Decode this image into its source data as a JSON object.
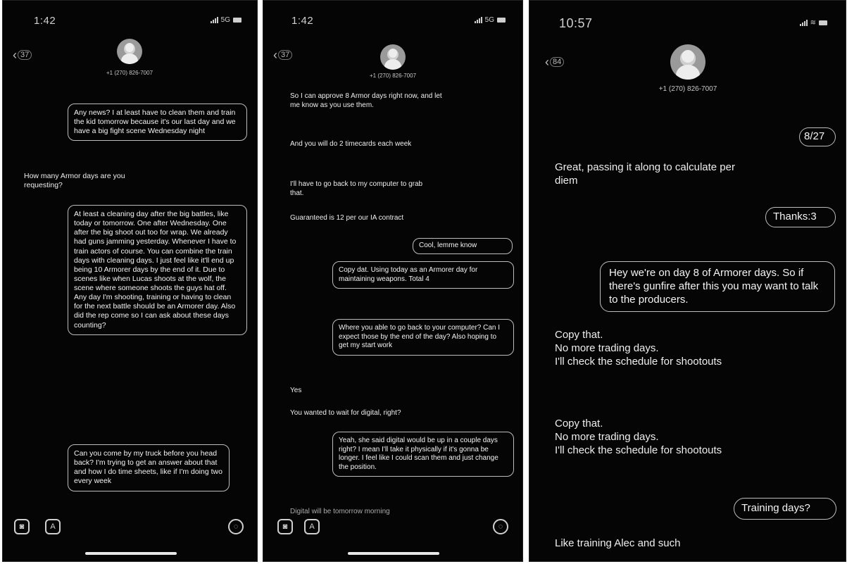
{
  "panels": [
    {
      "status_time": "1:42",
      "status_net": "5G",
      "back_label": "37",
      "contact_phone": "+1 (270) 826-7007",
      "messages": [
        {
          "type": "outgoing",
          "text": "Any news? I at least have to clean them and train the kid tomorrow because it's our last day and we have a big fight scene Wednesday night"
        },
        {
          "type": "incoming",
          "text": "How many Armor days are you requesting?"
        },
        {
          "type": "outgoing",
          "text": "At least a cleaning day after the big battles, like today or tomorrow. One after Wednesday. One after the big shoot out too for wrap. We already had guns jamming yesterday. Whenever I have to train actors of course. You can combine the train days with cleaning days. I just feel like it'll end up being 10 Armorer days by the end of it. Due to scenes like when Lucas shoots at the wolf, the scene where someone shoots the guys hat off. Any day I'm shooting, training or having to clean for the next battle should be an Armorer day. Also did the rep come so I can ask about these days counting?"
        },
        {
          "type": "outgoing",
          "text": "Can you come by my truck before you head back? I'm trying to get an answer about that and how I do time sheets, like if I'm doing two every week"
        }
      ]
    },
    {
      "status_time": "1:42",
      "status_net": "5G",
      "back_label": "37",
      "contact_phone": "+1 (270) 826-7007",
      "messages": [
        {
          "type": "incoming",
          "text": "So I can approve 8 Armor days right now, and let me know as you use them."
        },
        {
          "type": "incoming",
          "text": "And you will do 2 timecards each week"
        },
        {
          "type": "incoming",
          "text": "I'll have to go back to my computer to grab that."
        },
        {
          "type": "incoming",
          "text": "Guaranteed is 12 per our IA contract"
        },
        {
          "type": "outgoing",
          "text": "Cool, lemme know"
        },
        {
          "type": "outgoing",
          "text": "Copy dat. Using today as an Armorer day for maintaining weapons. Total 4"
        },
        {
          "type": "outgoing",
          "text": "Where you able to go back to your computer? Can I expect those by the end of the day? Also hoping to get my start work"
        },
        {
          "type": "incoming",
          "text": "Yes"
        },
        {
          "type": "incoming",
          "text": "You wanted to wait for digital, right?"
        },
        {
          "type": "outgoing",
          "text": "Yeah, she said digital would be up in a couple days right? I mean I'll take it physically if it's gonna be longer. I feel like I could scan them and just change the position."
        },
        {
          "type": "incoming",
          "text": "Digital will be tomorrow morning"
        }
      ]
    },
    {
      "status_time": "10:57",
      "back_label": "84",
      "contact_phone": "+1 (270) 826-7007",
      "messages": [
        {
          "type": "outgoing",
          "text": "8/27"
        },
        {
          "type": "incoming",
          "text": "Great, passing it along to calculate per diem"
        },
        {
          "type": "outgoing",
          "text": "Thanks:3"
        },
        {
          "type": "outgoing",
          "text": "Hey we're on day 8 of Armorer days. So if there's gunfire after this you may want to talk to the producers."
        },
        {
          "type": "incoming",
          "text": "Copy that.\nNo more trading days.\nI'll check the schedule for shootouts"
        },
        {
          "type": "incoming",
          "text": "Copy that.\nNo more trading days.\nI'll check the schedule for shootouts"
        },
        {
          "type": "outgoing",
          "text": "Training days?"
        },
        {
          "type": "incoming",
          "text": "Like training Alec and such"
        }
      ]
    }
  ],
  "icons": {
    "camera": "camera-icon",
    "appstore": "app-store-icon",
    "audio": "audio-icon",
    "back": "chevron-left-icon"
  },
  "colors": {
    "background": "#050505",
    "bubble_border": "#bdbdbd",
    "text": "#f2f2f2"
  }
}
